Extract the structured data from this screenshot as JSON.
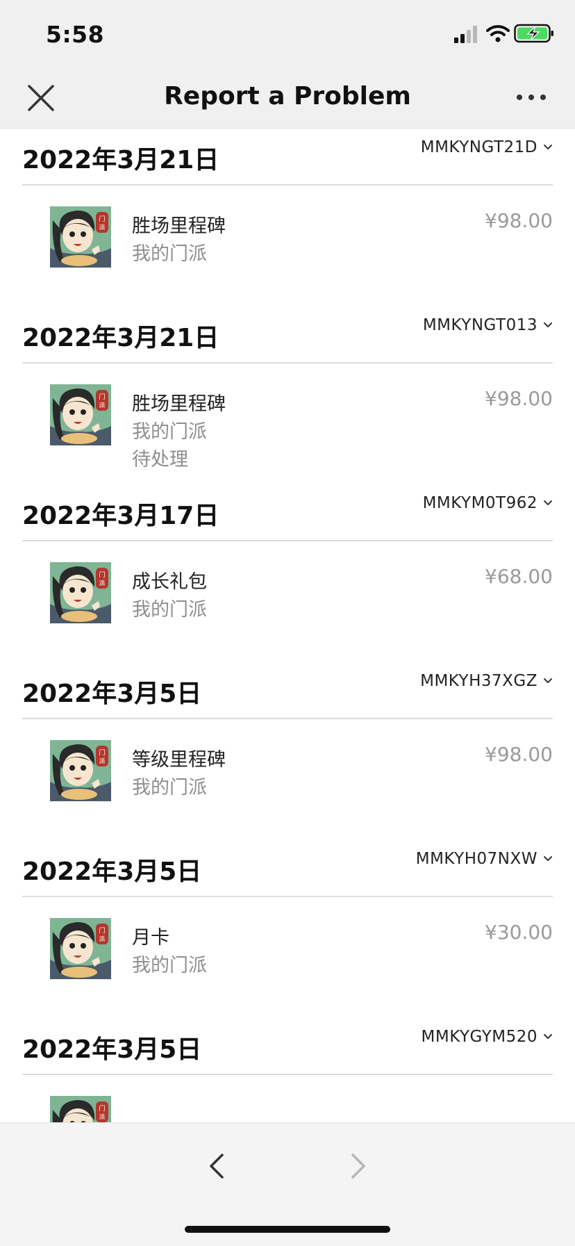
{
  "status_bar": {
    "time": "5:58"
  },
  "nav": {
    "title": "Report a Problem"
  },
  "orders": [
    {
      "date": "2022年3月21日",
      "id": "MMKYNGT21D",
      "name": "胜场里程碑",
      "game": "我的门派",
      "status": "",
      "price": "¥98.00"
    },
    {
      "date": "2022年3月21日",
      "id": "MMKYNGT013",
      "name": "胜场里程碑",
      "game": "我的门派",
      "status": "待处理",
      "price": "¥98.00"
    },
    {
      "date": "2022年3月17日",
      "id": "MMKYM0T962",
      "name": "成长礼包",
      "game": "我的门派",
      "status": "",
      "price": "¥68.00"
    },
    {
      "date": "2022年3月5日",
      "id": "MMKYH37XGZ",
      "name": "等级里程碑",
      "game": "我的门派",
      "status": "",
      "price": "¥98.00"
    },
    {
      "date": "2022年3月5日",
      "id": "MMKYH07NXW",
      "name": "月卡",
      "game": "我的门派",
      "status": "",
      "price": "¥30.00"
    },
    {
      "date": "2022年3月5日",
      "id": "MMKYGYM520",
      "name": "",
      "game": "",
      "status": "",
      "price": ""
    }
  ],
  "icons": {
    "close": "close-icon",
    "more": "more-icon",
    "back": "chevron-left-icon",
    "forward": "chevron-right-icon",
    "expand": "chevron-down-icon",
    "app": "app-icon-wode-menpai"
  },
  "colors": {
    "bar_background": "#f0f0f0",
    "secondary_text": "#8e8e8e",
    "battery_green": "#4cd964"
  }
}
